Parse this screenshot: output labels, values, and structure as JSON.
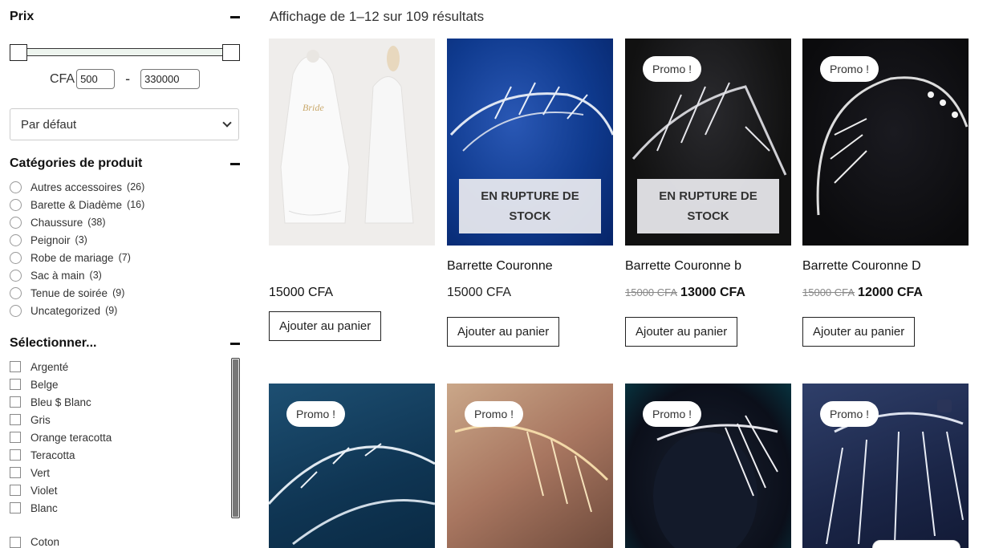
{
  "sidebar": {
    "price": {
      "title": "Prix",
      "currency": "CFA",
      "min": "500",
      "max": "330000",
      "separator": "-"
    },
    "sort": {
      "selected": "Par défaut"
    },
    "categories": {
      "title": "Catégories de produit",
      "items": [
        {
          "label": "Autres accessoires",
          "count": "(26)"
        },
        {
          "label": "Barette & Diadème",
          "count": "(16)"
        },
        {
          "label": "Chaussure",
          "count": "(38)"
        },
        {
          "label": "Peignoir",
          "count": "(3)"
        },
        {
          "label": "Robe de mariage",
          "count": "(7)"
        },
        {
          "label": "Sac à main",
          "count": "(3)"
        },
        {
          "label": "Tenue de soirée",
          "count": "(9)"
        },
        {
          "label": "Uncategorized",
          "count": "(9)"
        }
      ]
    },
    "attributes": {
      "title": "Sélectionner...",
      "items": [
        "Argenté",
        "Belge",
        "Bleu $ Blanc",
        "Gris",
        "Orange teracotta",
        "Teracotta",
        "Vert",
        "Violet",
        "Blanc"
      ],
      "extra": "Coton"
    }
  },
  "main": {
    "result_count": "Affichage de 1–12 sur 109 résultats",
    "add_to_cart": "Ajouter au panier",
    "promo_badge": "Promo !",
    "out_of_stock": "EN RUPTURE DE STOCK",
    "products": [
      {
        "name": "",
        "price": "15000 CFA",
        "old_price": "",
        "promo": false,
        "oos": false
      },
      {
        "name": "Barrette Couronne",
        "price": "15000 CFA",
        "old_price": "",
        "promo": false,
        "oos": true
      },
      {
        "name": "Barrette Couronne b",
        "price": "13000 CFA",
        "old_price": "15000 CFA",
        "promo": true,
        "oos": true
      },
      {
        "name": "Barrette Couronne D",
        "price": "12000 CFA",
        "old_price": "15000 CFA",
        "promo": true,
        "oos": false
      },
      {
        "promo": true
      },
      {
        "promo": true
      },
      {
        "promo": true
      },
      {
        "promo": true
      }
    ]
  }
}
